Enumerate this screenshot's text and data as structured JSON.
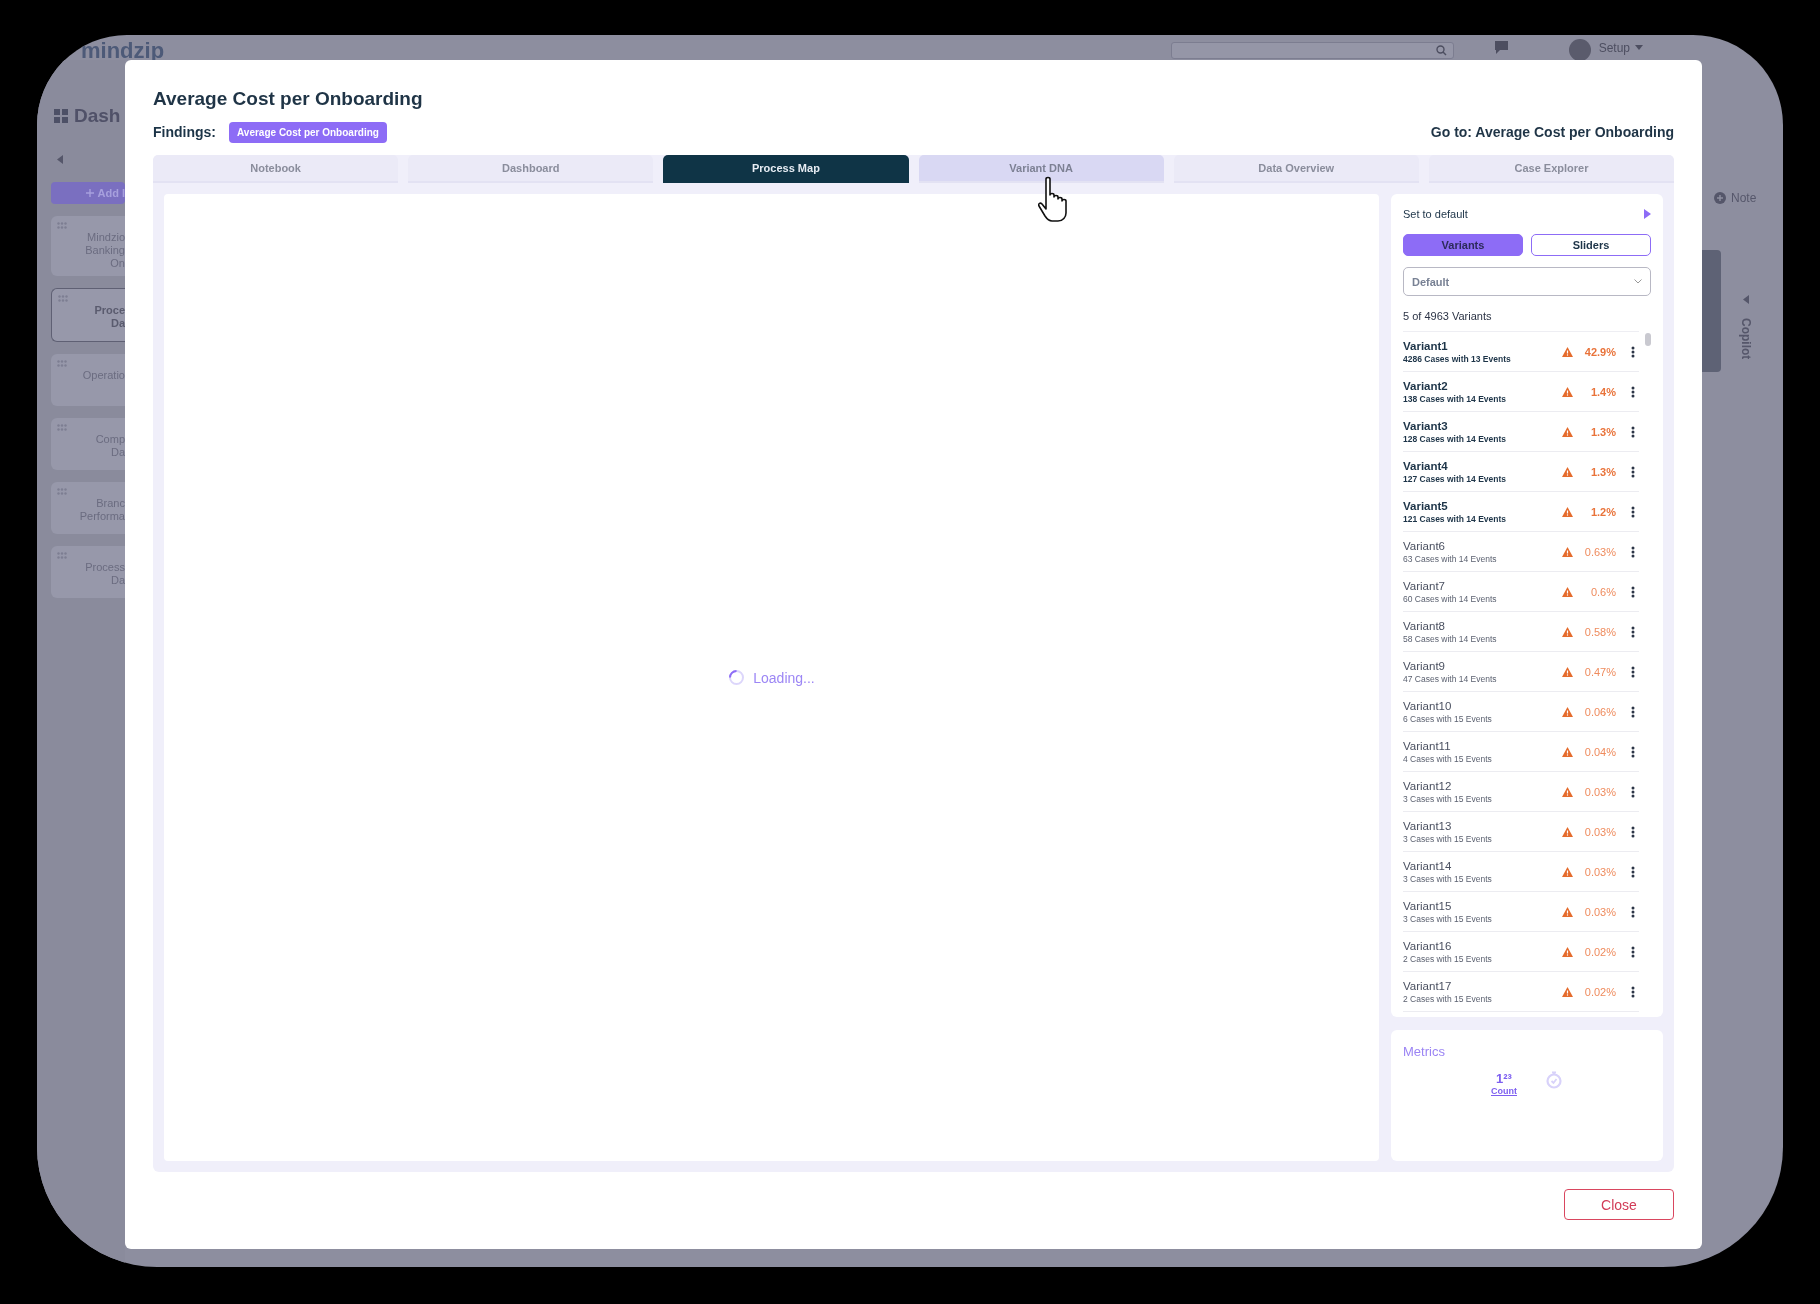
{
  "background_app": {
    "logo": "mindzip",
    "user_menu": "Setup",
    "page_title": "Dash",
    "add_button": "Add I",
    "sidebar_cards": [
      {
        "lines": [
          "Mindzio",
          "Banking",
          "On"
        ],
        "selected": false
      },
      {
        "lines": [
          "Proce",
          "Da"
        ],
        "selected": true
      },
      {
        "lines": [
          "Operatio"
        ],
        "selected": false
      },
      {
        "lines": [
          "Comp",
          "Da"
        ],
        "selected": false
      },
      {
        "lines": [
          "Branc",
          "Performa"
        ],
        "selected": false
      },
      {
        "lines": [
          "Process",
          "Da"
        ],
        "selected": false
      }
    ],
    "note_button": "Note",
    "copilot_label": "Copilot"
  },
  "dialog": {
    "title": "Average Cost per Onboarding",
    "findings_label": "Findings:",
    "findings_badge": "Average Cost per Onboarding",
    "goto_link": "Go to: Average Cost per Onboarding",
    "tabs": [
      {
        "label": "Notebook",
        "selected": false,
        "hovered": false
      },
      {
        "label": "Dashboard",
        "selected": false,
        "hovered": false
      },
      {
        "label": "Process Map",
        "selected": true,
        "hovered": false
      },
      {
        "label": "Variant DNA",
        "selected": false,
        "hovered": true
      },
      {
        "label": "Data Overview",
        "selected": false,
        "hovered": false
      },
      {
        "label": "Case Explorer",
        "selected": false,
        "hovered": false
      }
    ],
    "loading_text": "Loading...",
    "variants_panel": {
      "reset_link": "Set to default",
      "view_toggle": [
        {
          "label": "Variants",
          "selected": true
        },
        {
          "label": "Sliders",
          "selected": false
        }
      ],
      "filter_dropdown": {
        "value": "Default"
      },
      "summary": "5 of 4963 Variants",
      "variants": [
        {
          "name": "Variant1",
          "cases": "4286 Cases with 13 Events",
          "share": "42.9%",
          "selected": true
        },
        {
          "name": "Variant2",
          "cases": "138 Cases with 14 Events",
          "share": "1.4%",
          "selected": true
        },
        {
          "name": "Variant3",
          "cases": "128 Cases with 14 Events",
          "share": "1.3%",
          "selected": true
        },
        {
          "name": "Variant4",
          "cases": "127 Cases with 14 Events",
          "share": "1.3%",
          "selected": true
        },
        {
          "name": "Variant5",
          "cases": "121 Cases with 14 Events",
          "share": "1.2%",
          "selected": true
        },
        {
          "name": "Variant6",
          "cases": "63 Cases with 14 Events",
          "share": "0.63%",
          "selected": false
        },
        {
          "name": "Variant7",
          "cases": "60 Cases with 14 Events",
          "share": "0.6%",
          "selected": false
        },
        {
          "name": "Variant8",
          "cases": "58 Cases with 14 Events",
          "share": "0.58%",
          "selected": false
        },
        {
          "name": "Variant9",
          "cases": "47 Cases with 14 Events",
          "share": "0.47%",
          "selected": false
        },
        {
          "name": "Variant10",
          "cases": "6 Cases with 15 Events",
          "share": "0.06%",
          "selected": false
        },
        {
          "name": "Variant11",
          "cases": "4 Cases with 15 Events",
          "share": "0.04%",
          "selected": false
        },
        {
          "name": "Variant12",
          "cases": "3 Cases with 15 Events",
          "share": "0.03%",
          "selected": false
        },
        {
          "name": "Variant13",
          "cases": "3 Cases with 15 Events",
          "share": "0.03%",
          "selected": false
        },
        {
          "name": "Variant14",
          "cases": "3 Cases with 15 Events",
          "share": "0.03%",
          "selected": false
        },
        {
          "name": "Variant15",
          "cases": "3 Cases with 15 Events",
          "share": "0.03%",
          "selected": false
        },
        {
          "name": "Variant16",
          "cases": "2 Cases with 15 Events",
          "share": "0.02%",
          "selected": false
        },
        {
          "name": "Variant17",
          "cases": "2 Cases with 15 Events",
          "share": "0.02%",
          "selected": false
        }
      ]
    },
    "metrics": {
      "title": "Metrics",
      "items": [
        {
          "kind": "count",
          "symbol": "1²³",
          "label": "Count",
          "selected": true
        },
        {
          "kind": "duration",
          "selected": false
        }
      ]
    },
    "close_button": "Close"
  }
}
